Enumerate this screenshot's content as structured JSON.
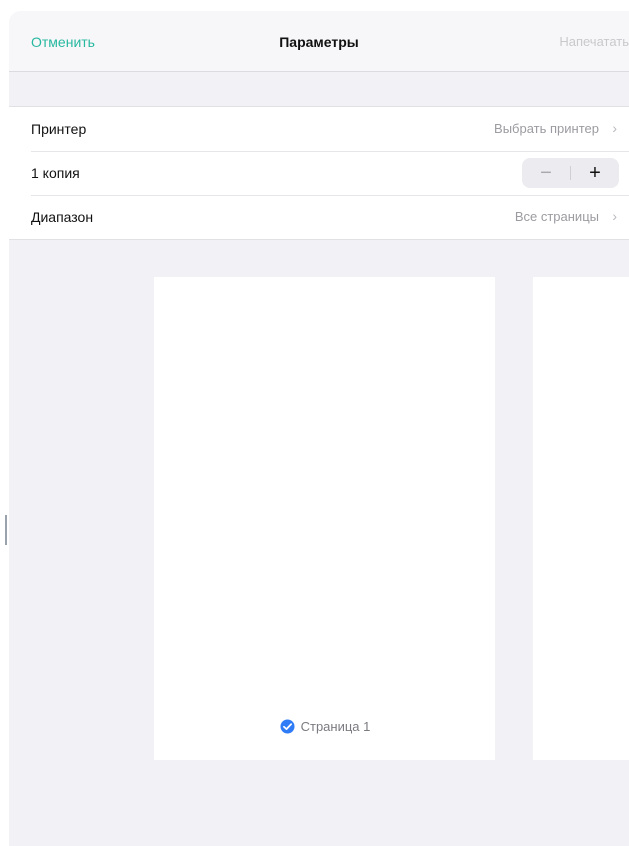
{
  "navbar": {
    "cancel_label": "Отменить",
    "title": "Параметры",
    "print_label": "Напечатать"
  },
  "settings": {
    "printer": {
      "label": "Принтер",
      "value": "Выбрать принтер"
    },
    "copies": {
      "label": "1 копия",
      "minus": "−",
      "plus": "+"
    },
    "range": {
      "label": "Диапазон",
      "value": "Все страницы"
    }
  },
  "preview": {
    "pages": [
      {
        "label": "Страница 1",
        "selected": true
      }
    ]
  },
  "colors": {
    "accent": "#27b8a0",
    "check": "#2f7cf6",
    "background": "#f2f2f6"
  },
  "icons": {
    "chevron": "chevron-right-icon",
    "check": "checkmark-circle-icon"
  }
}
